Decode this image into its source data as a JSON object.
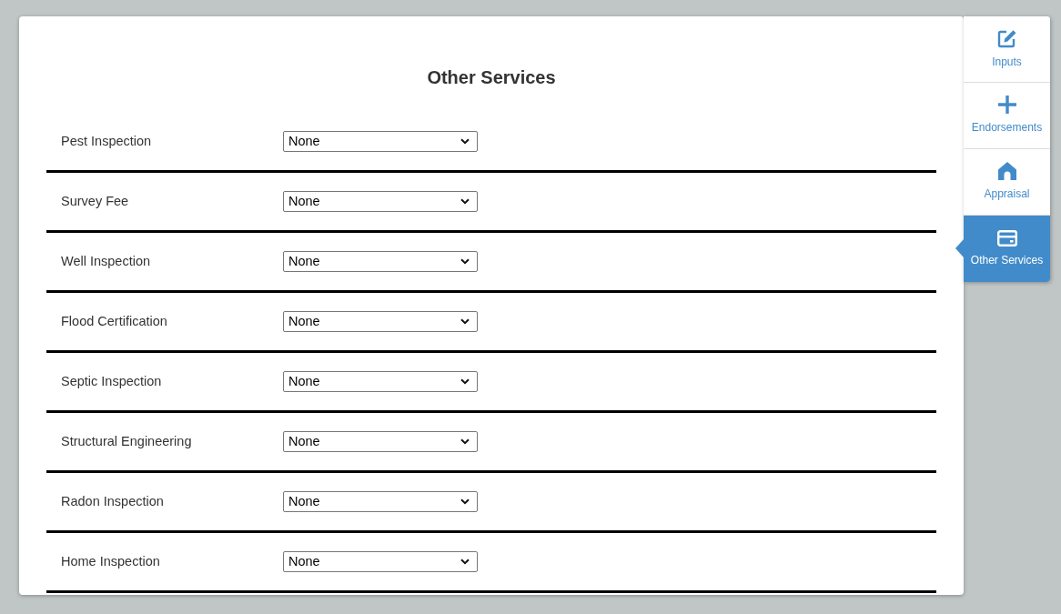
{
  "title": "Other Services",
  "services": [
    {
      "label": "Pest Inspection",
      "value": "None"
    },
    {
      "label": "Survey Fee",
      "value": "None"
    },
    {
      "label": "Well Inspection",
      "value": "None"
    },
    {
      "label": "Flood Certification",
      "value": "None"
    },
    {
      "label": "Septic Inspection",
      "value": "None"
    },
    {
      "label": "Structural Engineering",
      "value": "None"
    },
    {
      "label": "Radon Inspection",
      "value": "None"
    },
    {
      "label": "Home Inspection",
      "value": "None"
    }
  ],
  "side_tabs": [
    {
      "label": "Inputs",
      "selected": false
    },
    {
      "label": "Endorsements",
      "selected": false
    },
    {
      "label": "Appraisal",
      "selected": false
    },
    {
      "label": "Other Services",
      "selected": true
    }
  ]
}
